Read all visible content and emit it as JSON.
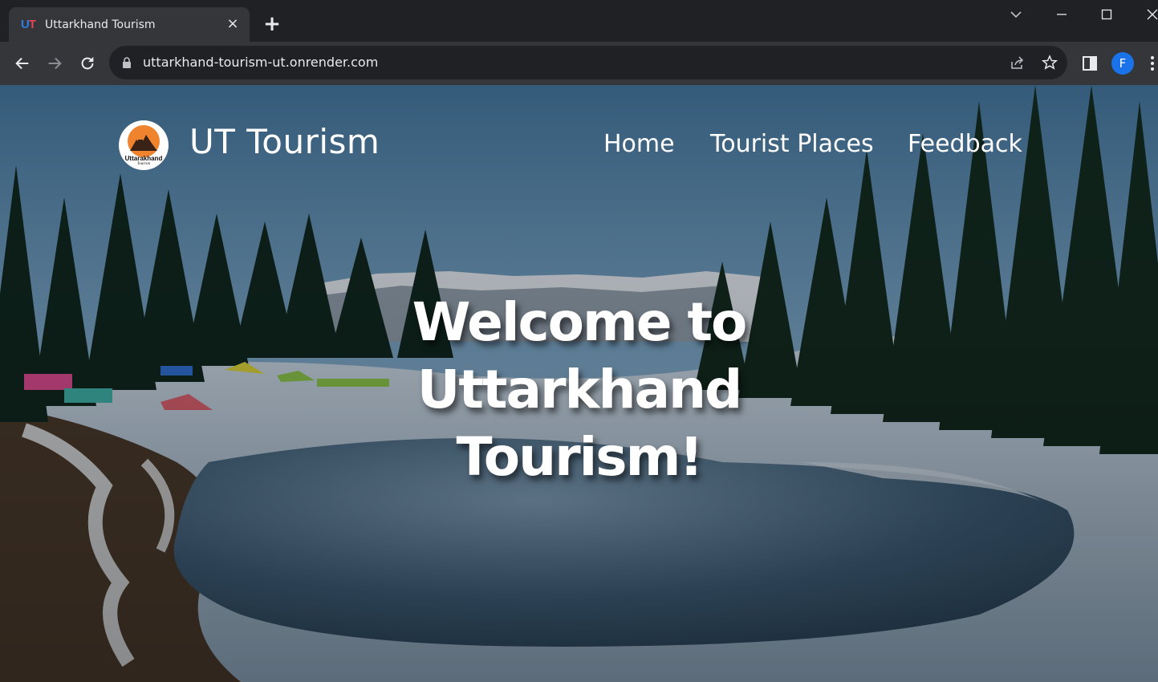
{
  "browser": {
    "tab": {
      "favicon_text_u": "U",
      "favicon_text_t": "T",
      "title": "Uttarkhand Tourism",
      "close_glyph": "×"
    },
    "new_tab_glyph": "+",
    "address_bar": {
      "url": "uttarkhand-tourism-ut.onrender.com"
    },
    "profile_initial": "F",
    "icons": [
      "tab-search-icon",
      "minimize-icon",
      "maximize-icon",
      "close-window-icon",
      "back-icon",
      "forward-icon",
      "reload-icon",
      "lock-icon",
      "share-icon",
      "star-icon",
      "side-panel-icon",
      "menu-icon"
    ],
    "colors": {
      "frame": "#202124",
      "toolbar": "#35363a",
      "text": "#e8eaed",
      "avatar": "#1a73e8"
    }
  },
  "site": {
    "logo_text": "Uttarakhand",
    "logo_subtext": "Tourism",
    "brand": "UT Tourism",
    "nav": [
      {
        "label": "Home"
      },
      {
        "label": "Tourist Places"
      },
      {
        "label": "Feedback"
      }
    ],
    "hero": {
      "line1": "Welcome to",
      "line2": "Uttarkhand",
      "line3": "Tourism!"
    },
    "colors": {
      "text": "#ffffff",
      "logo_accent": "#f0832e"
    }
  }
}
